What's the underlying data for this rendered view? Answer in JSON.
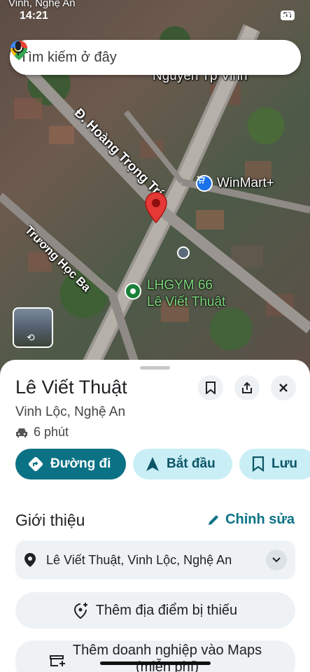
{
  "status_bar": {
    "location": "Vinh, Nghệ An",
    "time": "14:21",
    "battery": "55"
  },
  "search": {
    "placeholder": "Tìm kiếm ở đây"
  },
  "map": {
    "labels": {
      "street_hoang": "Đ. Hoàng Trọng Trí",
      "street_truong": "Trương Học Ba",
      "place_nguyen": "Nguyễn Tp Vinh",
      "winmart": "WinMart+",
      "gym_line1": "LHGYM 66",
      "gym_line2": "Lê Viết Thuật"
    }
  },
  "place": {
    "name": "Lê Viết Thuật",
    "area": "Vinh Lộc, Nghệ An",
    "eta": "6 phút"
  },
  "actions": {
    "directions": "Đường đi",
    "start": "Bắt đầu",
    "save": "Lưu"
  },
  "about": {
    "title": "Giới thiệu",
    "edit": "Chỉnh sửa",
    "address": "Lê Viết Thuật, Vinh Lộc, Nghệ An",
    "add_missing": "Thêm địa điểm bị thiếu",
    "add_business": "Thêm doanh nghiệp vào Maps",
    "add_business_sub": "(miễn phí)"
  },
  "colors": {
    "primary": "#0b7285",
    "pin_red": "#e53935",
    "winmart_blue": "#1a73e8",
    "gym_green": "#188038"
  }
}
